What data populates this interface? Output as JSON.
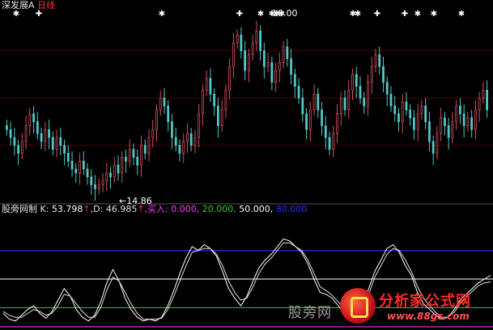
{
  "stock_title": "深发展A",
  "period": "日线",
  "indicator": {
    "name": "股旁网制",
    "k_label": "K:",
    "k_value": "53.798",
    "k_arrow": "↑",
    "d_label": ",D:",
    "d_value": "46.985",
    "d_arrow": "↑",
    "buy_label": ",买入:",
    "buy_values": [
      "0.000,",
      "20.000,",
      "50.000,",
      "80.000"
    ]
  },
  "price_low_label": "14.86",
  "price_high_label": "19.00",
  "watermark_text": "股旁网",
  "logo": {
    "title": "分析家公式网",
    "url": "www.88gs.com"
  },
  "colors": {
    "background": "#000000",
    "up_candle": "#d05060",
    "down_candle": "#50c8c8",
    "k_line": "#ffffff",
    "d_line": "#dddddd",
    "level_0": "#ff40ff",
    "level_20": "#30d030",
    "level_50": "#ffffff",
    "level_80": "#3030ff"
  },
  "chart_data": [
    {
      "type": "candlestick",
      "title": "深发展A 日线",
      "annotations": [
        {
          "text": "14.86",
          "kind": "period-low"
        },
        {
          "text": "19.00",
          "kind": "period-high"
        }
      ],
      "signal_markers": [
        "star",
        "plus",
        "star",
        "plus",
        "star",
        "star",
        "star",
        "star",
        "star",
        "star",
        "plus",
        "plus",
        "star",
        "star",
        "star"
      ],
      "closes": [
        16.4,
        16.2,
        16.0,
        15.8,
        16.1,
        16.5,
        16.8,
        16.6,
        16.3,
        16.1,
        16.4,
        16.2,
        15.9,
        16.2,
        16.0,
        15.8,
        15.6,
        15.4,
        15.3,
        15.6,
        15.4,
        15.2,
        15.0,
        14.9,
        15.0,
        15.1,
        15.3,
        15.2,
        15.5,
        15.3,
        15.7,
        15.6,
        15.9,
        15.7,
        15.5,
        16.0,
        15.8,
        16.2,
        16.4,
        16.9,
        17.2,
        17.0,
        16.6,
        16.2,
        16.0,
        15.8,
        16.1,
        16.3,
        16.0,
        16.2,
        16.8,
        17.4,
        17.7,
        17.3,
        17.0,
        16.5,
        16.9,
        17.4,
        18.0,
        18.6,
        18.8,
        18.4,
        17.9,
        18.3,
        18.6,
        18.9,
        18.4,
        18.0,
        18.1,
        17.6,
        17.9,
        18.1,
        18.5,
        18.2,
        17.8,
        17.5,
        17.2,
        16.8,
        16.4,
        16.9,
        17.3,
        16.9,
        16.5,
        16.2,
        15.9,
        16.3,
        16.8,
        17.2,
        16.9,
        17.4,
        17.8,
        17.5,
        17.2,
        17.0,
        17.6,
        18.0,
        18.3,
        18.0,
        17.6,
        17.3,
        17.0,
        16.8,
        16.6,
        17.1,
        16.9,
        16.7,
        16.4,
        16.8,
        17.0,
        16.6,
        16.1,
        15.8,
        16.3,
        16.7,
        16.5,
        16.2,
        16.6,
        17.0,
        16.8,
        16.5,
        16.7,
        16.4,
        16.9,
        17.2,
        17.4,
        16.9
      ]
    },
    {
      "type": "line",
      "title": "股旁网制",
      "ylim": [
        0,
        100
      ],
      "levels": [
        0,
        20,
        50,
        80
      ],
      "series": [
        {
          "name": "K",
          "values": [
            14,
            8,
            6,
            12,
            18,
            22,
            14,
            9,
            16,
            28,
            40,
            32,
            18,
            10,
            6,
            12,
            26,
            46,
            60,
            48,
            30,
            18,
            10,
            6,
            8,
            6,
            10,
            22,
            38,
            56,
            72,
            84,
            80,
            86,
            82,
            74,
            58,
            40,
            30,
            22,
            32,
            48,
            62,
            70,
            76,
            84,
            92,
            90,
            84,
            78,
            66,
            50,
            36,
            34,
            30,
            22,
            14,
            8,
            10,
            22,
            40,
            58,
            70,
            82,
            86,
            78,
            64,
            54,
            36,
            24,
            18,
            12,
            8,
            10,
            18,
            28,
            34,
            40,
            46,
            50,
            53.8
          ]
        },
        {
          "name": "D",
          "values": [
            16,
            12,
            10,
            10,
            14,
            18,
            16,
            12,
            14,
            22,
            34,
            32,
            24,
            16,
            10,
            10,
            20,
            38,
            52,
            48,
            36,
            24,
            14,
            8,
            8,
            8,
            9,
            18,
            32,
            48,
            64,
            78,
            80,
            82,
            82,
            76,
            64,
            48,
            36,
            28,
            30,
            42,
            56,
            66,
            72,
            80,
            88,
            88,
            84,
            80,
            70,
            56,
            42,
            38,
            33,
            26,
            18,
            11,
            10,
            18,
            34,
            52,
            64,
            76,
            82,
            80,
            70,
            58,
            42,
            30,
            22,
            15,
            10,
            10,
            15,
            24,
            31,
            37,
            43,
            46,
            47.0
          ]
        }
      ]
    }
  ]
}
